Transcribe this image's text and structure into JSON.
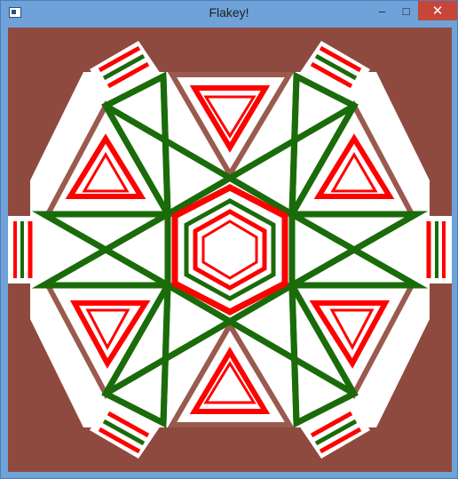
{
  "window": {
    "title": "Flakey!",
    "controls": {
      "minimize": "–",
      "maximize": "□",
      "close": "✕"
    }
  },
  "colors": {
    "background": "#8f4a3f",
    "white": "#ffffff",
    "green": "#1a6b0a",
    "red": "#ff0000",
    "brown": "#9a5a4e"
  }
}
